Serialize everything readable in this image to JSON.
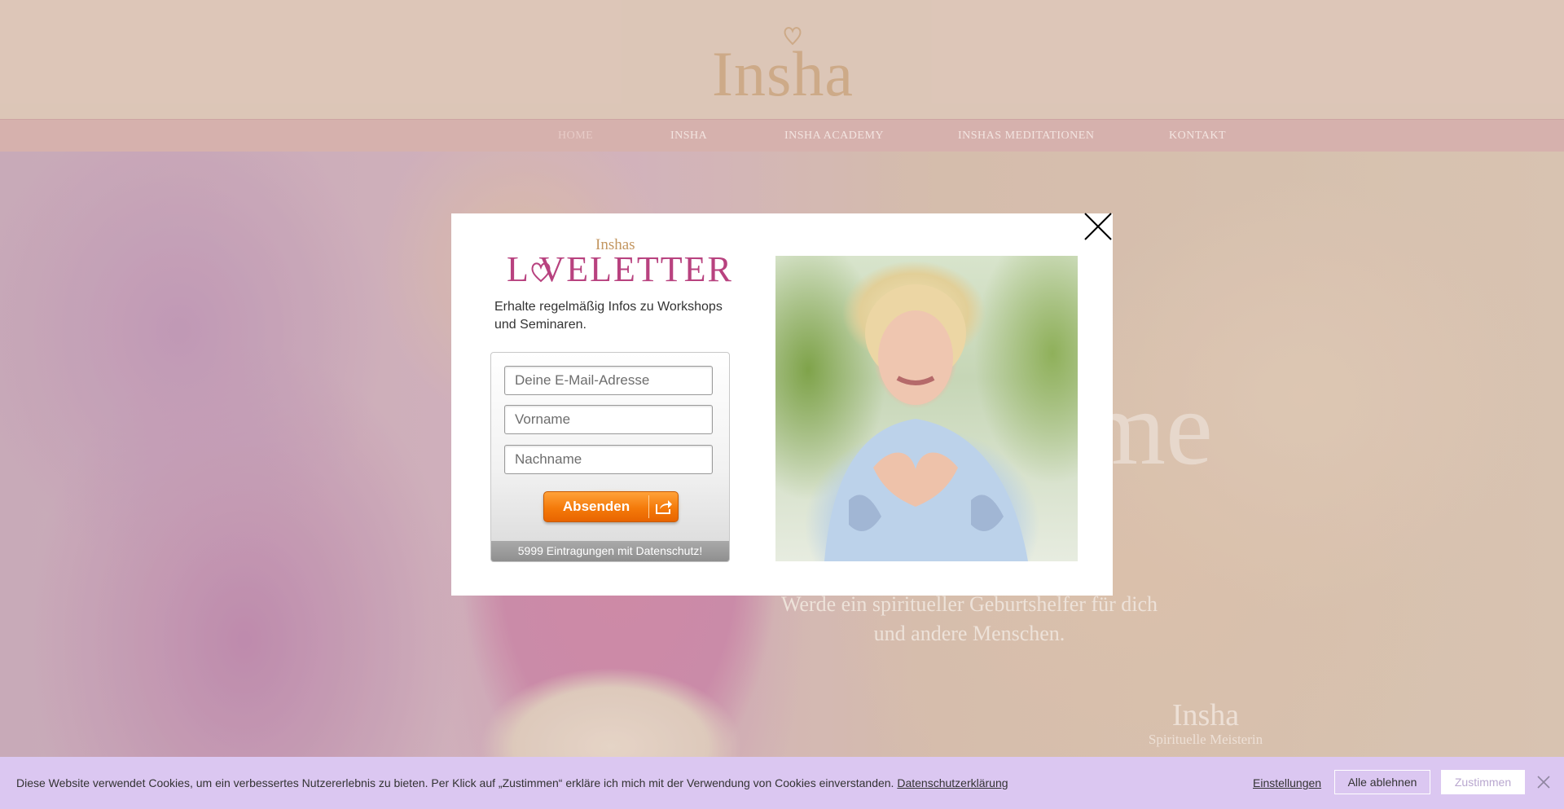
{
  "header": {
    "logo_text": "Insha"
  },
  "nav": {
    "items": [
      {
        "label": "HOME",
        "active": true
      },
      {
        "label": "INSHA",
        "active": false
      },
      {
        "label": "INSHA ACADEMY",
        "active": false
      },
      {
        "label": "INSHAS MEDITATIONEN",
        "active": false
      },
      {
        "label": "KONTAKT",
        "active": false
      }
    ]
  },
  "hero": {
    "big_text": "me",
    "subtitle_line1": "Werde ein spiritueller Geburtshelfer für dich",
    "subtitle_line2": "und andere Menschen.",
    "signature_name": "Insha",
    "signature_title": "Spirituelle Meisterin"
  },
  "modal": {
    "kicker": "Inshas",
    "title": "L   VELETTER",
    "description": "Erhalte regelmäßig Infos zu Workshops und Seminaren.",
    "form": {
      "email_placeholder": "Deine E-Mail-Adresse",
      "firstname_placeholder": "Vorname",
      "lastname_placeholder": "Nachname",
      "submit_label": "Absenden",
      "footer_text": "5999 Eintragungen mit Datenschutz!"
    },
    "photo_icon": "portrait-photo"
  },
  "cookie_banner": {
    "text": "Diese Website verwendet Cookies, um ein verbessertes Nutzererlebnis zu bieten. Per Klick auf „Zustimmen“ erkläre ich mich mit der Verwendung von Cookies einverstanden.",
    "privacy_link": "Datenschutzerklärung",
    "settings_label": "Einstellungen",
    "reject_label": "Alle ablehnen",
    "accept_label": "Zustimmen"
  },
  "colors": {
    "header_bg": "#dbc2b3",
    "nav_bg": "#d4a9a6",
    "logo": "#c9a079",
    "newsletter_title": "#b8427f",
    "submit_orange": "#f47a0a",
    "cookie_bg": "#dbc7f1"
  }
}
